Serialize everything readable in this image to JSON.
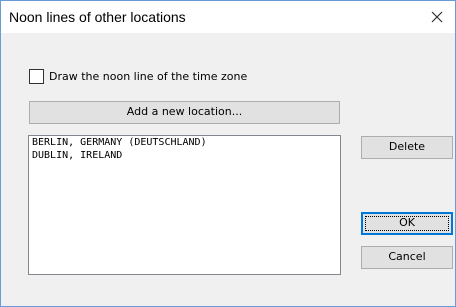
{
  "dialog": {
    "title": "Noon lines of other locations",
    "close_icon": "close-icon"
  },
  "checkbox": {
    "label": "Draw the noon line of the time zone",
    "checked": false
  },
  "buttons": {
    "add_location": "Add a new location...",
    "delete": "Delete",
    "ok": "OK",
    "cancel": "Cancel"
  },
  "locations": [
    "BERLIN, GERMANY (DEUTSCHLAND)",
    "DUBLIN, IRELAND"
  ]
}
